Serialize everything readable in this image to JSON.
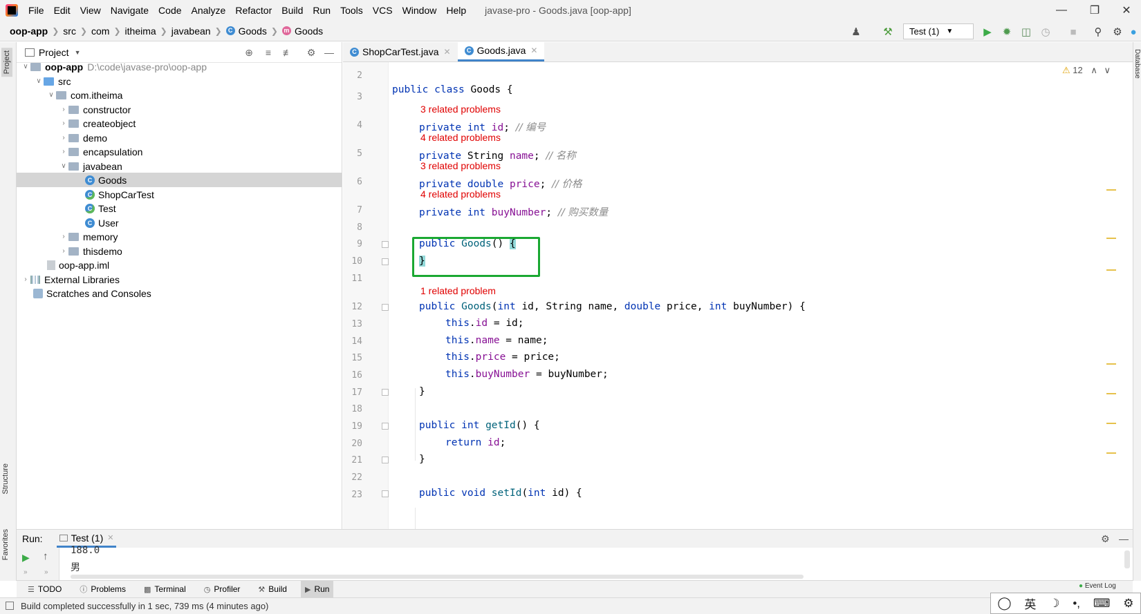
{
  "menubar": {
    "items": [
      "File",
      "Edit",
      "View",
      "Navigate",
      "Code",
      "Analyze",
      "Refactor",
      "Build",
      "Run",
      "Tools",
      "VCS",
      "Window",
      "Help"
    ],
    "title": "javase-pro - Goods.java [oop-app]"
  },
  "navbar": {
    "crumbs": [
      "oop-app",
      "src",
      "com",
      "itheima",
      "javabean",
      "Goods",
      "Goods"
    ],
    "run_config": "Test (1)"
  },
  "left_stripe": {
    "project": "Project",
    "structure": "Structure",
    "favorites": "Favorites"
  },
  "right_stripe": {
    "database": "Database"
  },
  "project": {
    "header": "Project",
    "root_name": "oop-app",
    "root_path": "D:\\code\\javase-pro\\oop-app",
    "src": "src",
    "package": "com.itheima",
    "folders": [
      "constructor",
      "createobject",
      "demo",
      "encapsulation"
    ],
    "javabean": "javabean",
    "classes": [
      "Goods",
      "ShopCarTest",
      "Test",
      "User"
    ],
    "folders2": [
      "memory",
      "thisdemo"
    ],
    "iml": "oop-app.iml",
    "external": "External Libraries",
    "scratches": "Scratches and Consoles"
  },
  "tabs": [
    "ShopCarTest.java",
    "Goods.java"
  ],
  "editor": {
    "warnings": "12",
    "line_numbers": [
      "2",
      "3",
      "4",
      "5",
      "6",
      "7",
      "8",
      "9",
      "10",
      "11",
      "12",
      "13",
      "14",
      "15",
      "16",
      "17",
      "18",
      "19",
      "20",
      "21",
      "22",
      "23"
    ],
    "problems": [
      "3 related problems",
      "4 related problems",
      "3 related problems",
      "4 related problems",
      "1 related problem"
    ],
    "comments": [
      "// 编号",
      "// 名称",
      "// 价格",
      "// 购买数量"
    ],
    "kw": {
      "public": "public",
      "class": "class",
      "private": "private",
      "int": "int",
      "double": "double",
      "return": "return",
      "void": "void",
      "this": "this"
    },
    "types": {
      "goods": "Goods",
      "string": "String"
    },
    "fields": {
      "id": "id",
      "name": "name",
      "price": "price",
      "buyNumber": "buyNumber"
    },
    "methods": {
      "getId": "getId",
      "setId": "setId",
      "goods": "Goods"
    }
  },
  "run": {
    "label": "Run:",
    "tab": "Test (1)",
    "output": [
      "188.0",
      "男"
    ]
  },
  "bottom_tabs": [
    "TODO",
    "Problems",
    "Terminal",
    "Profiler",
    "Build",
    "Run"
  ],
  "status": {
    "message": "Build completed successfully in 1 sec, 739 ms (4 minutes ago)",
    "event_log": "Event Log"
  },
  "ime": {
    "lang": "英"
  },
  "colors": {
    "keyword": "#0033b3",
    "field": "#871094",
    "problem": "#e00000",
    "highlight": "#1aa832"
  }
}
